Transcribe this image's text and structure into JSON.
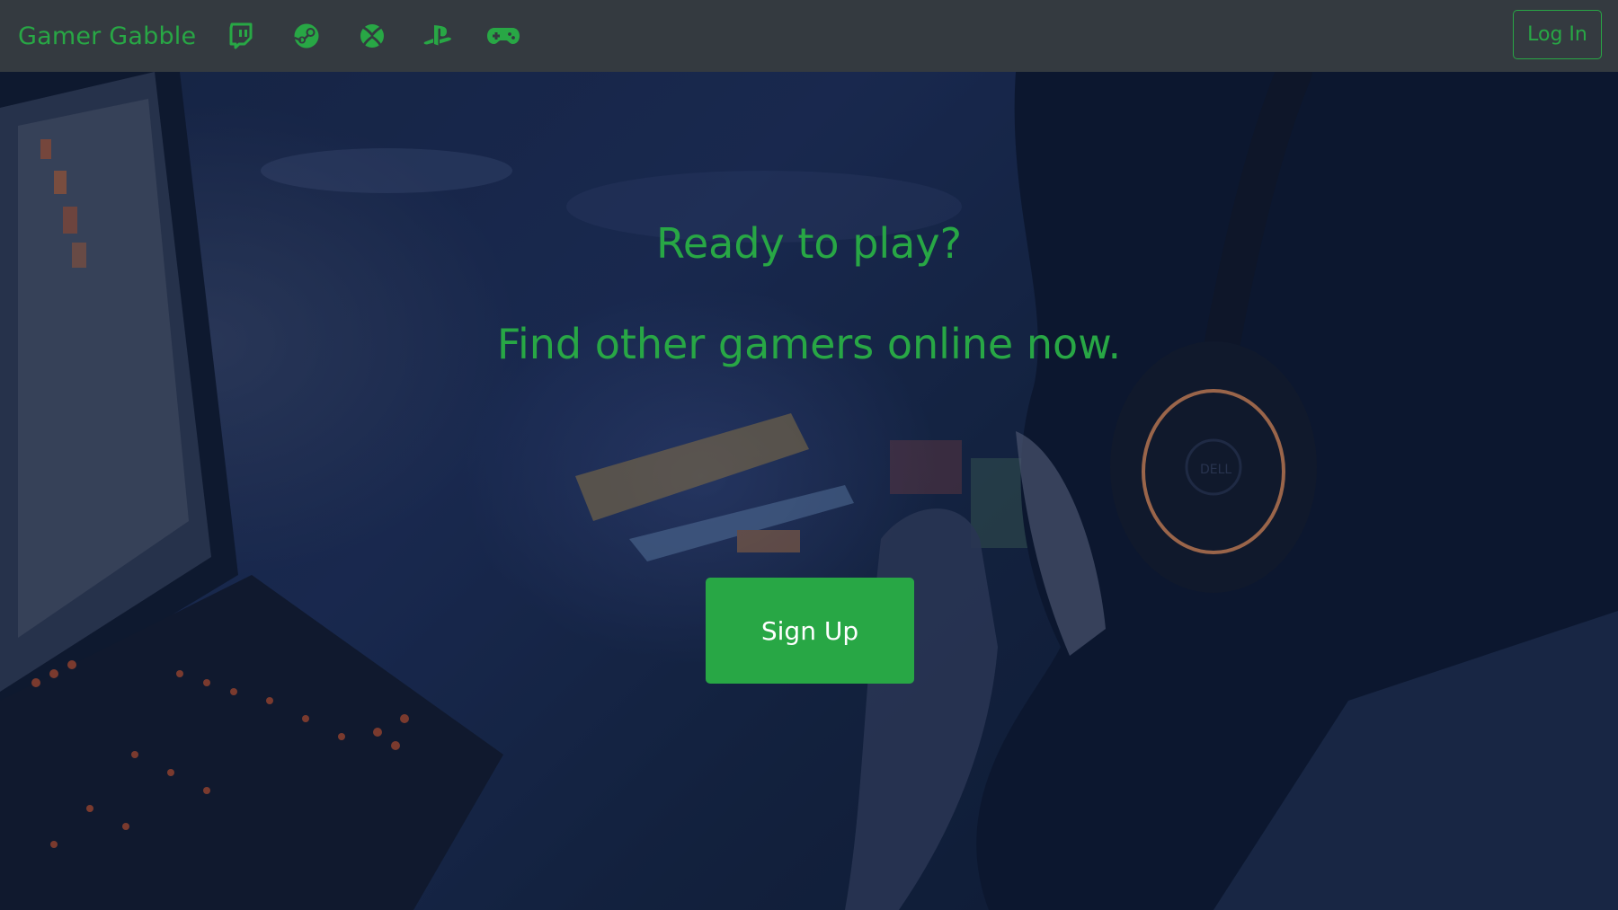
{
  "navbar": {
    "brand": "Gamer Gabble",
    "icons": [
      "twitch-icon",
      "steam-icon",
      "xbox-icon",
      "playstation-icon",
      "gamepad-icon"
    ],
    "login_label": "Log In"
  },
  "hero": {
    "headline": "Ready to play?",
    "subheadline": "Find other gamers online now.",
    "signup_label": "Sign Up"
  },
  "colors": {
    "accent": "#28a745",
    "navbar_bg": "#343a40",
    "button_text": "#ffffff"
  }
}
